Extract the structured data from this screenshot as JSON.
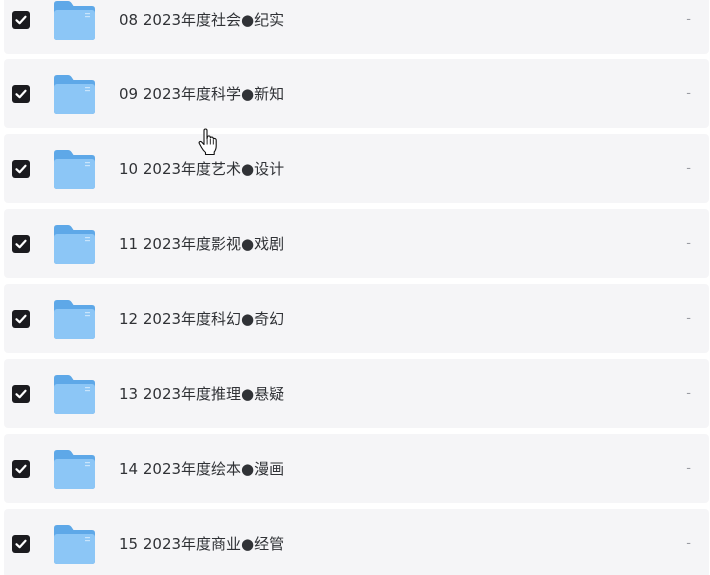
{
  "files": [
    {
      "name": "08 2023年度社会●纪实",
      "size": "-",
      "checked": true
    },
    {
      "name": "09 2023年度科学●新知",
      "size": "-",
      "checked": true
    },
    {
      "name": "10 2023年度艺术●设计",
      "size": "-",
      "checked": true
    },
    {
      "name": "11 2023年度影视●戏剧",
      "size": "-",
      "checked": true
    },
    {
      "name": "12 2023年度科幻●奇幻",
      "size": "-",
      "checked": true
    },
    {
      "name": "13 2023年度推理●悬疑",
      "size": "-",
      "checked": true
    },
    {
      "name": "14 2023年度绘本●漫画",
      "size": "-",
      "checked": true
    },
    {
      "name": "15 2023年度商业●经管",
      "size": "-",
      "checked": true
    }
  ],
  "icons": {
    "checkbox": "check-icon",
    "folder": "folder-icon",
    "cursor": "hand-pointer-icon"
  },
  "colors": {
    "row_background": "#f5f5f7",
    "checkbox_fill": "#1b1b1f",
    "folder_blue": "#6fb3ee",
    "text": "#303236",
    "muted": "#9a9ca3"
  }
}
